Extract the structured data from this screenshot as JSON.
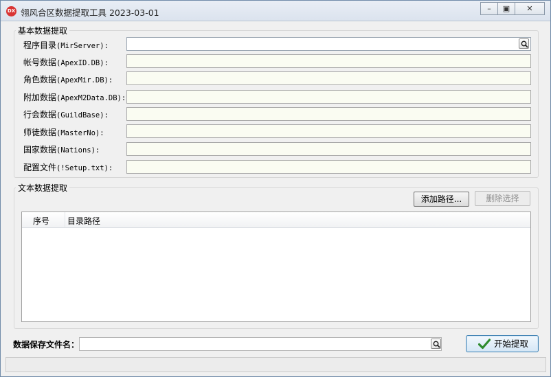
{
  "window": {
    "icon_text": "DX",
    "title": "翎风合区数据提取工具 2023-03-01",
    "minimize_glyph": "–",
    "maximize_glyph": "▣",
    "close_glyph": "✕"
  },
  "basic": {
    "title": "基本数据提取",
    "rows": [
      {
        "label": "程序目录",
        "code": "(MirServer):",
        "value": ""
      },
      {
        "label": "帐号数据",
        "code": "(ApexID.DB):",
        "value": ""
      },
      {
        "label": "角色数据",
        "code": "(ApexMir.DB):",
        "value": ""
      },
      {
        "label": "附加数据",
        "code": "(ApexM2Data.DB):",
        "value": ""
      },
      {
        "label": "行会数据",
        "code": "(GuildBase):",
        "value": ""
      },
      {
        "label": "师徒数据",
        "code": "(MasterNo):",
        "value": ""
      },
      {
        "label": "国家数据",
        "code": "(Nations):",
        "value": ""
      },
      {
        "label": "配置文件",
        "code": "(!Setup.txt):",
        "value": ""
      }
    ]
  },
  "text": {
    "title": "文本数据提取",
    "add_button": "添加路径...",
    "delete_button": "删除选择",
    "columns": [
      "序号",
      "目录路径"
    ],
    "rows": []
  },
  "bottom": {
    "save_label": "数据保存文件名：",
    "save_value": "",
    "start_button": "开始提取"
  },
  "colors": {
    "accent": "#3c7fb1",
    "check": "#2e8b2e",
    "field_bg": "#fafcf2"
  },
  "icons": [
    "app-icon",
    "search-icon",
    "check-icon"
  ]
}
